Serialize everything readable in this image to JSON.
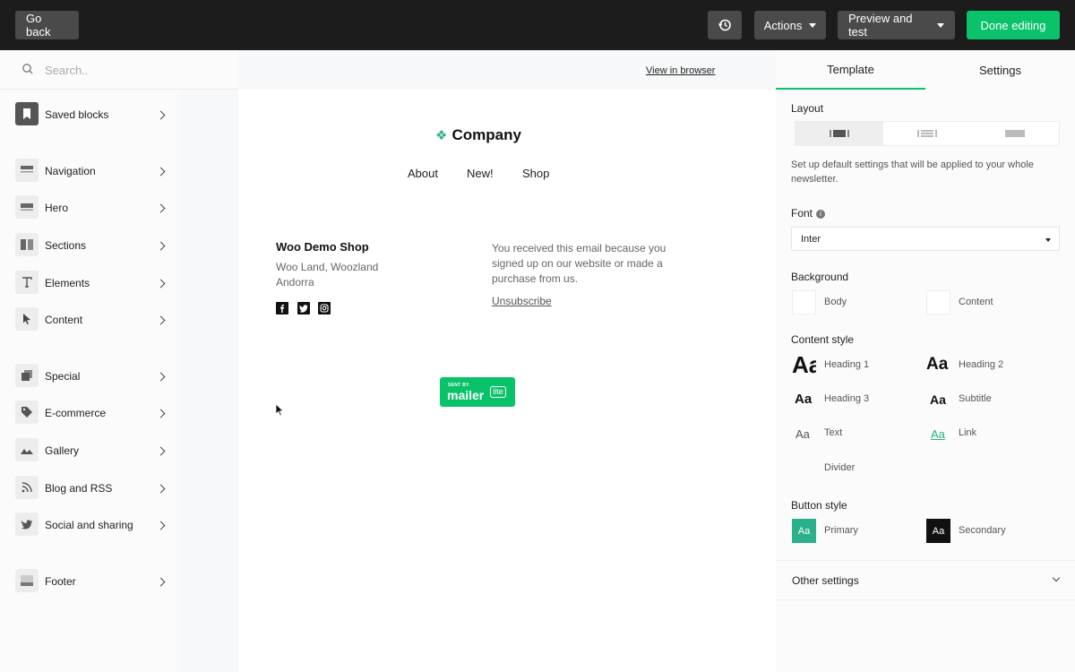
{
  "topbar": {
    "go_back": "Go back",
    "actions": "Actions",
    "preview": "Preview and test",
    "done": "Done editing"
  },
  "sidebar": {
    "search_placeholder": "Search..",
    "items": [
      {
        "label": "Saved blocks",
        "icon": "bookmark-icon"
      },
      {
        "label": "Navigation",
        "icon": "navigation-icon"
      },
      {
        "label": "Hero",
        "icon": "hero-icon"
      },
      {
        "label": "Sections",
        "icon": "sections-icon"
      },
      {
        "label": "Elements",
        "icon": "text-icon"
      },
      {
        "label": "Content",
        "icon": "cursor-icon"
      },
      {
        "label": "Special",
        "icon": "special-icon"
      },
      {
        "label": "E-commerce",
        "icon": "tag-icon"
      },
      {
        "label": "Gallery",
        "icon": "image-icon"
      },
      {
        "label": "Blog and RSS",
        "icon": "rss-icon"
      },
      {
        "label": "Social and sharing",
        "icon": "twitter-icon"
      },
      {
        "label": "Footer",
        "icon": "footer-icon"
      }
    ]
  },
  "email": {
    "view_in_browser": "View in browser",
    "company": "Company",
    "nav": [
      "About",
      "New!",
      "Shop"
    ],
    "shop_name": "Woo Demo Shop",
    "address_line1": "Woo Land, Woozland",
    "address_line2": "Andorra",
    "received_text": "You received this email because you signed up on our website or made a purchase from us.",
    "unsubscribe": "Unsubscribe",
    "badge_sent_by": "SENT BY",
    "badge_mailer": "mailer",
    "badge_lite": "lite"
  },
  "panel": {
    "tabs": [
      "Template",
      "Settings"
    ],
    "layout_label": "Layout",
    "description": "Set up default settings that will be applied to your whole newsletter.",
    "font_label": "Font",
    "font_value": "Inter",
    "background_label": "Background",
    "bg_body": "Body",
    "bg_content": "Content",
    "content_style_label": "Content style",
    "styles": {
      "sample": "Aa",
      "heading1": "Heading 1",
      "heading2": "Heading 2",
      "heading3": "Heading 3",
      "subtitle": "Subtitle",
      "text": "Text",
      "link": "Link",
      "divider": "Divider"
    },
    "button_style_label": "Button style",
    "primary": "Primary",
    "secondary": "Secondary",
    "other_settings": "Other settings"
  },
  "colors": {
    "accent": "#09c269",
    "primary_button": "#2ab08a",
    "secondary_button": "#111111",
    "link": "#2ab08a"
  }
}
